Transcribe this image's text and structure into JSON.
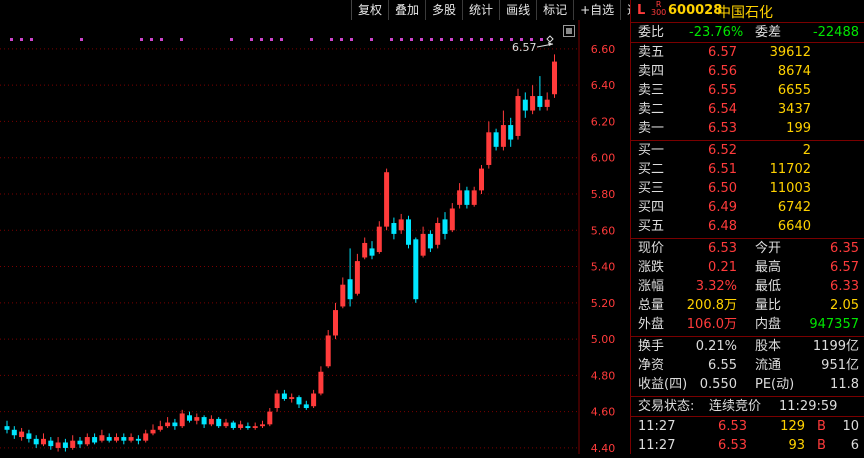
{
  "toolbar": [
    "复权",
    "叠加",
    "多股",
    "统计",
    "画线",
    "标记",
    "+自选",
    "返回"
  ],
  "price_axis": [
    "6.60",
    "6.40",
    "6.20",
    "6.00",
    "5.80",
    "5.60",
    "5.40",
    "5.20",
    "5.00",
    "4.80",
    "4.60",
    "4.40"
  ],
  "high_marker": "6.57",
  "colors": {
    "up": "#ff3b3b",
    "down": "#00e6ff",
    "grid": "#7a0000",
    "magenta": "#cc44cc"
  },
  "stock": {
    "board_L": "L",
    "board_R": "R",
    "board_num": "300",
    "code": "600028",
    "name": "中国石化"
  },
  "ratio": {
    "wb_label": "委比",
    "wb_value": "-23.76%",
    "wc_label": "委差",
    "wc_value": "-22488"
  },
  "asks": [
    {
      "label": "卖五",
      "price": "6.57",
      "vol": "39612"
    },
    {
      "label": "卖四",
      "price": "6.56",
      "vol": "8674"
    },
    {
      "label": "卖三",
      "price": "6.55",
      "vol": "6655"
    },
    {
      "label": "卖二",
      "price": "6.54",
      "vol": "3437"
    },
    {
      "label": "卖一",
      "price": "6.53",
      "vol": "199"
    }
  ],
  "bids": [
    {
      "label": "买一",
      "price": "6.52",
      "vol": "2"
    },
    {
      "label": "买二",
      "price": "6.51",
      "vol": "11702"
    },
    {
      "label": "买三",
      "price": "6.50",
      "vol": "11003"
    },
    {
      "label": "买四",
      "price": "6.49",
      "vol": "6742"
    },
    {
      "label": "买五",
      "price": "6.48",
      "vol": "6640"
    }
  ],
  "quote": [
    {
      "l1": "现价",
      "v1": "6.53",
      "l2": "今开",
      "v2": "6.35"
    },
    {
      "l1": "涨跌",
      "v1": "0.21",
      "l2": "最高",
      "v2": "6.57"
    },
    {
      "l1": "涨幅",
      "v1": "3.32%",
      "l2": "最低",
      "v2": "6.33"
    },
    {
      "l1": "总量",
      "v1": "200.8万",
      "l2": "量比",
      "v2": "2.05"
    },
    {
      "l1": "外盘",
      "v1": "106.0万",
      "l2": "内盘",
      "v2": "947357"
    }
  ],
  "fund": [
    {
      "l1": "换手",
      "v1": "0.21%",
      "l2": "股本",
      "v2": "1199亿"
    },
    {
      "l1": "净资",
      "v1": "6.55",
      "l2": "流通",
      "v2": "951亿"
    },
    {
      "l1": "收益(四)",
      "v1": "0.550",
      "l2": "PE(动)",
      "v2": "11.8"
    }
  ],
  "status": {
    "label": "交易状态:",
    "value": "连续竞价",
    "time": "11:29:59"
  },
  "ticks": [
    {
      "time": "11:27",
      "price": "6.53",
      "vol": "129",
      "side": "B",
      "count": "10"
    },
    {
      "time": "11:27",
      "price": "6.53",
      "vol": "93",
      "side": "B",
      "count": "6"
    }
  ],
  "chart_data": {
    "type": "candlestick",
    "ylim": [
      4.35,
      6.66
    ],
    "candles": [
      [
        4.52,
        4.5,
        4.55,
        4.48
      ],
      [
        4.5,
        4.47,
        4.52,
        4.45
      ],
      [
        4.46,
        4.49,
        4.51,
        4.44
      ],
      [
        4.48,
        4.45,
        4.5,
        4.43
      ],
      [
        4.45,
        4.42,
        4.47,
        4.4
      ],
      [
        4.42,
        4.45,
        4.48,
        4.41
      ],
      [
        4.44,
        4.41,
        4.46,
        4.39
      ],
      [
        4.4,
        4.43,
        4.46,
        4.38
      ],
      [
        4.43,
        4.4,
        4.45,
        4.38
      ],
      [
        4.4,
        4.44,
        4.47,
        4.39
      ],
      [
        4.44,
        4.42,
        4.46,
        4.4
      ],
      [
        4.42,
        4.46,
        4.48,
        4.41
      ],
      [
        4.46,
        4.43,
        4.48,
        4.42
      ],
      [
        4.44,
        4.47,
        4.5,
        4.43
      ],
      [
        4.46,
        4.44,
        4.48,
        4.43
      ],
      [
        4.44,
        4.46,
        4.48,
        4.43
      ],
      [
        4.46,
        4.44,
        4.48,
        4.42
      ],
      [
        4.44,
        4.46,
        4.48,
        4.43
      ],
      [
        4.45,
        4.44,
        4.47,
        4.42
      ],
      [
        4.44,
        4.48,
        4.5,
        4.43
      ],
      [
        4.48,
        4.5,
        4.53,
        4.47
      ],
      [
        4.5,
        4.52,
        4.55,
        4.49
      ],
      [
        4.52,
        4.54,
        4.57,
        4.51
      ],
      [
        4.54,
        4.52,
        4.56,
        4.5
      ],
      [
        4.52,
        4.59,
        4.61,
        4.51
      ],
      [
        4.58,
        4.55,
        4.6,
        4.54
      ],
      [
        4.55,
        4.57,
        4.59,
        4.53
      ],
      [
        4.57,
        4.53,
        4.58,
        4.51
      ],
      [
        4.53,
        4.56,
        4.58,
        4.52
      ],
      [
        4.56,
        4.52,
        4.57,
        4.51
      ],
      [
        4.52,
        4.54,
        4.56,
        4.51
      ],
      [
        4.54,
        4.51,
        4.55,
        4.5
      ],
      [
        4.51,
        4.53,
        4.55,
        4.5
      ],
      [
        4.52,
        4.51,
        4.54,
        4.5
      ],
      [
        4.51,
        4.52,
        4.54,
        4.5
      ],
      [
        4.52,
        4.53,
        4.55,
        4.51
      ],
      [
        4.53,
        4.6,
        4.62,
        4.52
      ],
      [
        4.62,
        4.7,
        4.72,
        4.6
      ],
      [
        4.7,
        4.67,
        4.72,
        4.66
      ],
      [
        4.67,
        4.68,
        4.7,
        4.65
      ],
      [
        4.68,
        4.64,
        4.69,
        4.62
      ],
      [
        4.64,
        4.62,
        4.66,
        4.61
      ],
      [
        4.63,
        4.7,
        4.72,
        4.62
      ],
      [
        4.7,
        4.82,
        4.85,
        4.69
      ],
      [
        4.85,
        5.02,
        5.05,
        4.84
      ],
      [
        5.02,
        5.16,
        5.2,
        5.0
      ],
      [
        5.18,
        5.3,
        5.34,
        5.17
      ],
      [
        5.33,
        5.22,
        5.5,
        5.18
      ],
      [
        5.25,
        5.43,
        5.47,
        5.24
      ],
      [
        5.45,
        5.53,
        5.56,
        5.44
      ],
      [
        5.5,
        5.46,
        5.54,
        5.44
      ],
      [
        5.48,
        5.62,
        5.65,
        5.47
      ],
      [
        5.62,
        5.92,
        5.94,
        5.6
      ],
      [
        5.64,
        5.58,
        5.67,
        5.55
      ],
      [
        5.6,
        5.66,
        5.69,
        5.58
      ],
      [
        5.66,
        5.52,
        5.68,
        5.5
      ],
      [
        5.55,
        5.22,
        5.56,
        5.2
      ],
      [
        5.46,
        5.58,
        5.62,
        5.45
      ],
      [
        5.58,
        5.5,
        5.6,
        5.48
      ],
      [
        5.52,
        5.64,
        5.67,
        5.5
      ],
      [
        5.66,
        5.58,
        5.7,
        5.55
      ],
      [
        5.6,
        5.72,
        5.75,
        5.59
      ],
      [
        5.74,
        5.82,
        5.86,
        5.72
      ],
      [
        5.82,
        5.74,
        5.84,
        5.72
      ],
      [
        5.74,
        5.82,
        5.84,
        5.73
      ],
      [
        5.82,
        5.94,
        5.96,
        5.8
      ],
      [
        5.96,
        6.14,
        6.2,
        5.94
      ],
      [
        6.14,
        6.06,
        6.16,
        6.04
      ],
      [
        6.06,
        6.18,
        6.26,
        6.04
      ],
      [
        6.18,
        6.1,
        6.22,
        6.06
      ],
      [
        6.12,
        6.34,
        6.38,
        6.1
      ],
      [
        6.32,
        6.26,
        6.36,
        6.22
      ],
      [
        6.26,
        6.34,
        6.4,
        6.24
      ],
      [
        6.34,
        6.28,
        6.45,
        6.26
      ],
      [
        6.28,
        6.32,
        6.36,
        6.26
      ],
      [
        6.35,
        6.53,
        6.57,
        6.33
      ]
    ]
  }
}
